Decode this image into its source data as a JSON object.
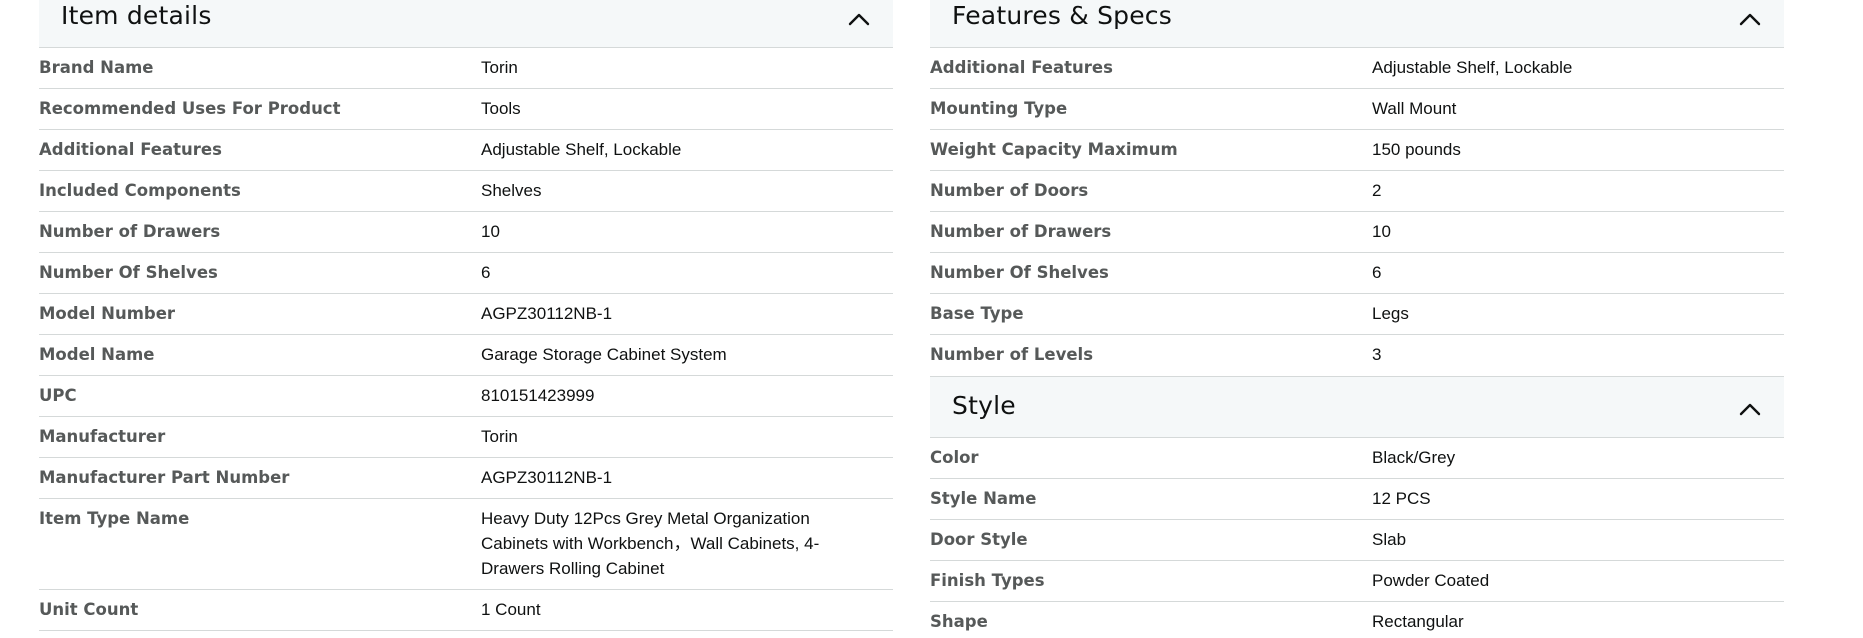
{
  "item_details": {
    "title": "Item details",
    "rows": [
      {
        "label": "Brand Name",
        "value": "Torin"
      },
      {
        "label": "Recommended Uses For Product",
        "value": "Tools"
      },
      {
        "label": "Additional Features",
        "value": "Adjustable Shelf, Lockable"
      },
      {
        "label": "Included Components",
        "value": "Shelves"
      },
      {
        "label": "Number of Drawers",
        "value": "10"
      },
      {
        "label": "Number Of Shelves",
        "value": "6"
      },
      {
        "label": "Model Number",
        "value": "AGPZ30112NB-1"
      },
      {
        "label": "Model Name",
        "value": "Garage Storage Cabinet System"
      },
      {
        "label": "UPC",
        "value": "810151423999"
      },
      {
        "label": "Manufacturer",
        "value": "Torin"
      },
      {
        "label": "Manufacturer Part Number",
        "value": "AGPZ30112NB-1"
      },
      {
        "label": "Item Type Name",
        "value": "Heavy Duty 12Pcs Grey Metal Organization Cabinets with Workbench，Wall Cabinets, 4-Drawers Rolling Cabinet"
      },
      {
        "label": "Unit Count",
        "value": "1 Count"
      }
    ]
  },
  "features_specs": {
    "title": "Features & Specs",
    "rows": [
      {
        "label": "Additional Features",
        "value": "Adjustable Shelf, Lockable"
      },
      {
        "label": "Mounting Type",
        "value": "Wall Mount"
      },
      {
        "label": "Weight Capacity Maximum",
        "value": "150 pounds"
      },
      {
        "label": "Number of Doors",
        "value": "2"
      },
      {
        "label": "Number of Drawers",
        "value": "10"
      },
      {
        "label": "Number Of Shelves",
        "value": "6"
      },
      {
        "label": "Base Type",
        "value": "Legs"
      },
      {
        "label": "Number of Levels",
        "value": "3"
      }
    ]
  },
  "style": {
    "title": "Style",
    "rows": [
      {
        "label": "Color",
        "value": "Black/Grey"
      },
      {
        "label": "Style Name",
        "value": "12 PCS"
      },
      {
        "label": "Door Style",
        "value": "Slab"
      },
      {
        "label": "Finish Types",
        "value": "Powder Coated"
      },
      {
        "label": "Shape",
        "value": "Rectangular"
      }
    ]
  },
  "icons": {
    "collapse": "chevron-up-icon"
  }
}
